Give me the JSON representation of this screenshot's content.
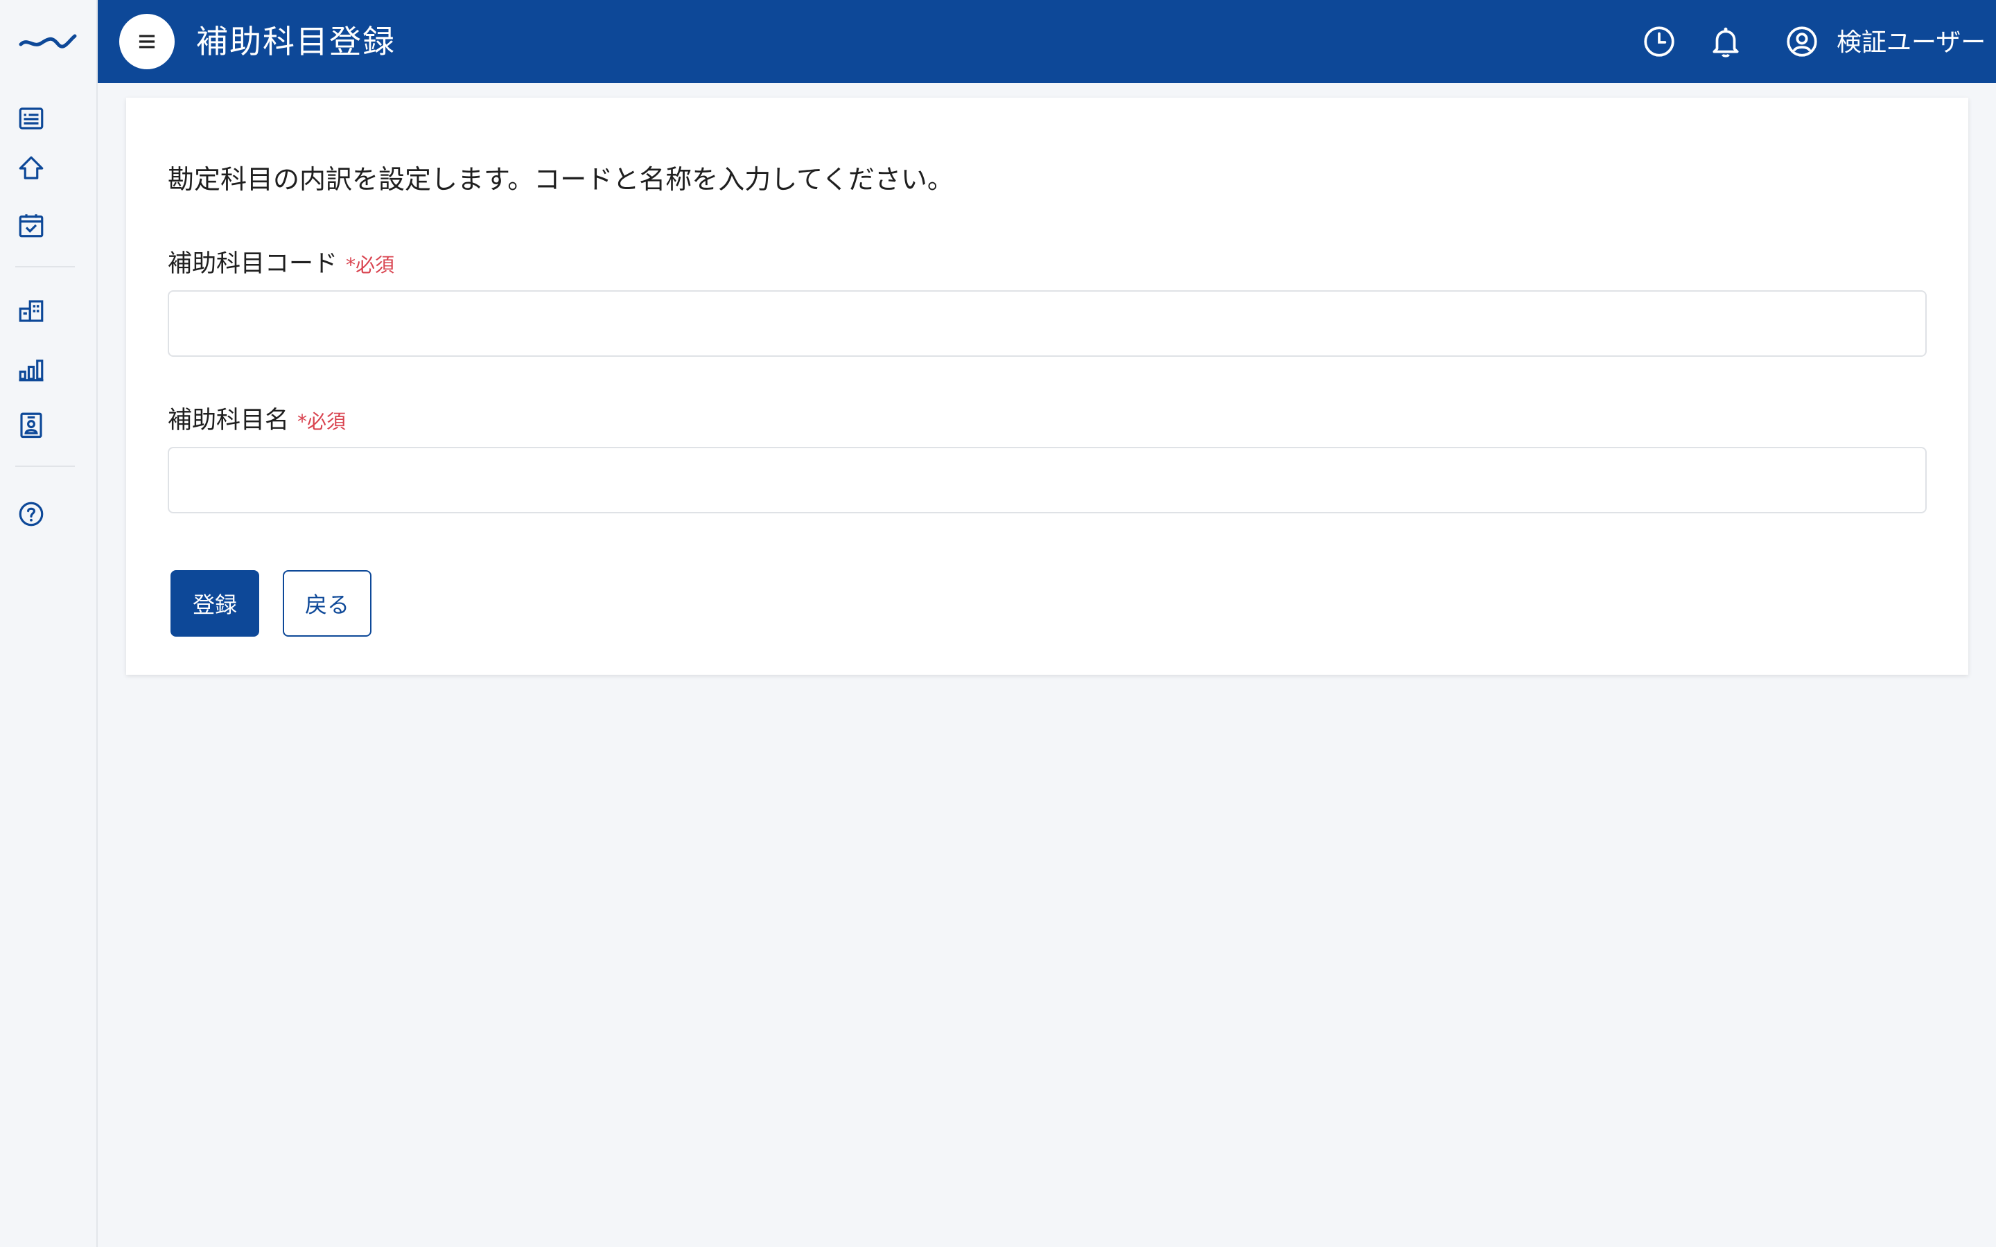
{
  "colors": {
    "brand": "#0d4898",
    "background": "#f4f6f9",
    "required": "#d9434f",
    "white": "#ffffff"
  },
  "header": {
    "title": "補助科目登録",
    "menu_icon": "hamburger-menu-icon",
    "history_icon": "clock-icon",
    "notification_icon": "bell-icon",
    "user_icon": "user-circle-icon",
    "user_name": "検証ユーザー"
  },
  "sidebar": {
    "logo_icon": "wave-logo-icon",
    "items": [
      {
        "icon": "list-icon"
      },
      {
        "icon": "home-icon"
      },
      {
        "icon": "calendar-check-icon"
      },
      {
        "icon": "building-icon"
      },
      {
        "icon": "bar-chart-icon"
      },
      {
        "icon": "id-badge-icon"
      },
      {
        "icon": "help-circle-icon"
      }
    ]
  },
  "form": {
    "intro": "勘定科目の内訳を設定します。コードと名称を入力してください。",
    "code_label": "補助科目コード",
    "name_label": "補助科目名",
    "required_text": "*必須",
    "code_value": "",
    "name_value": "",
    "submit_label": "登録",
    "back_label": "戻る"
  }
}
